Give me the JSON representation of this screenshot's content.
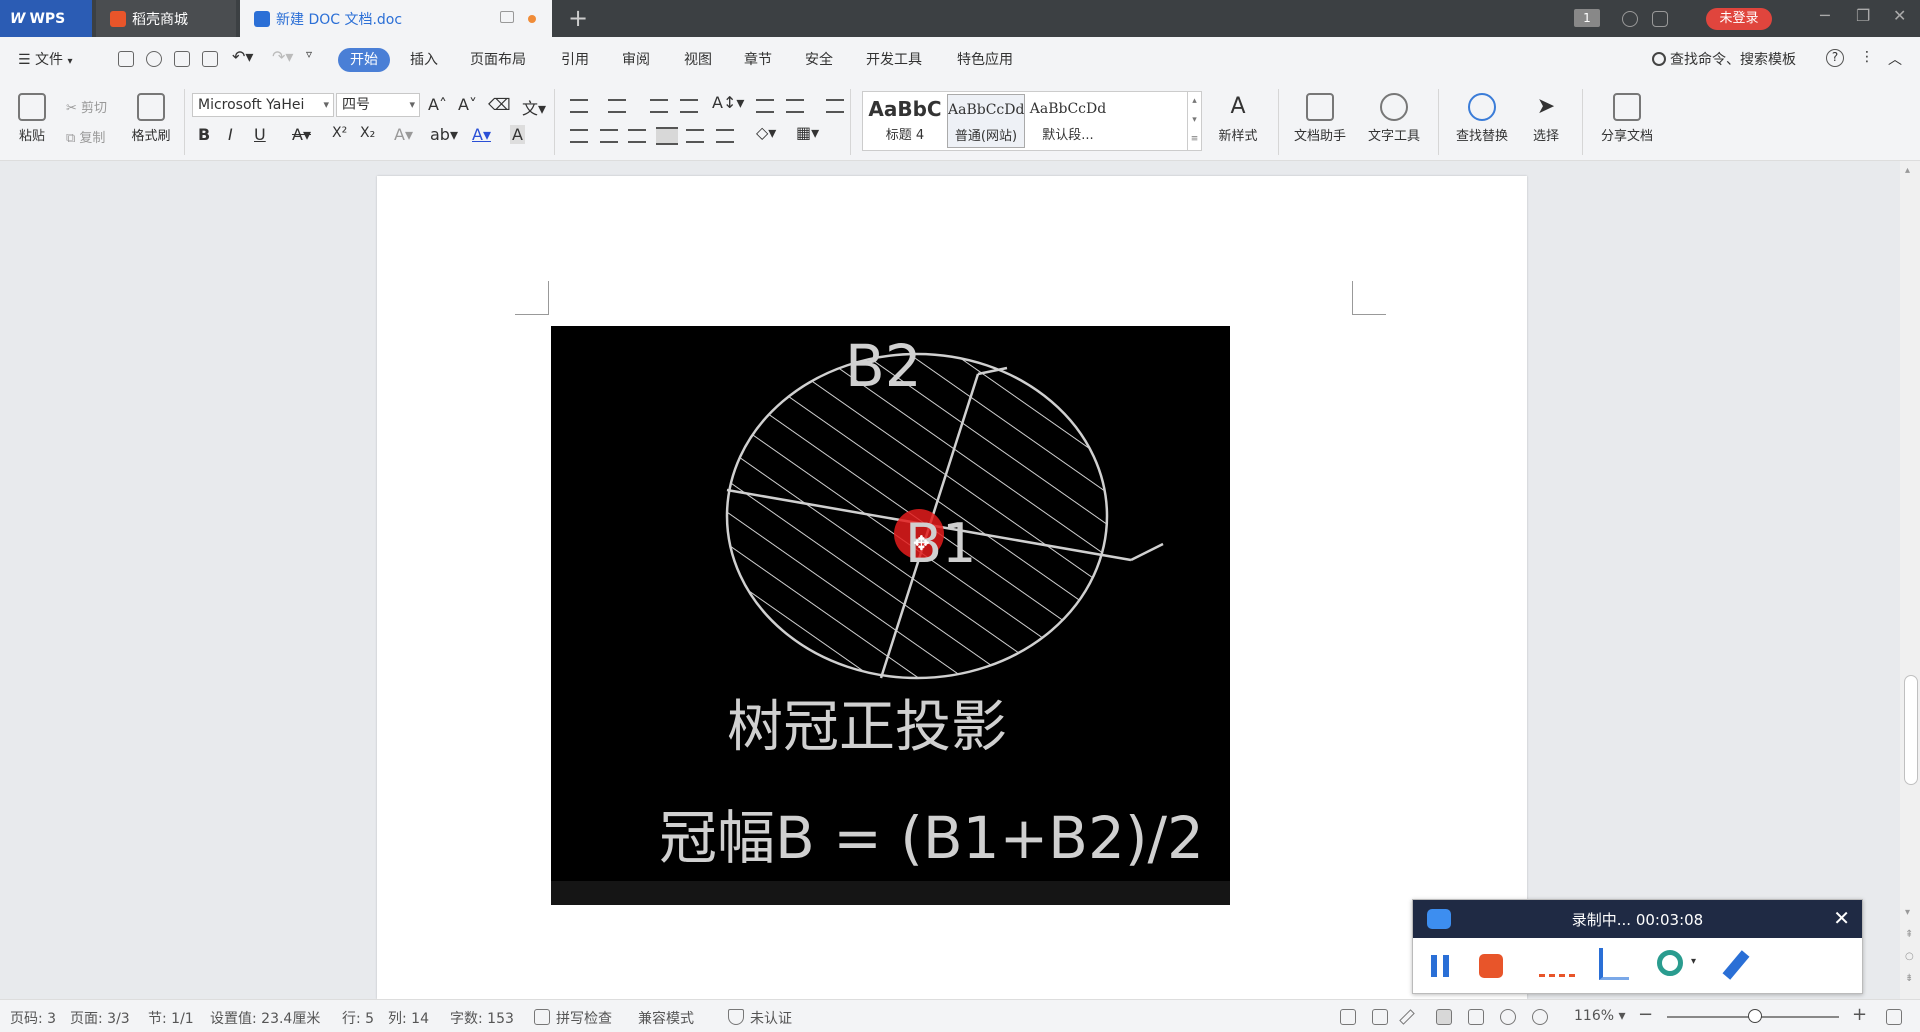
{
  "titlebar": {
    "app_tab": "WPS",
    "store_tab": "稻壳商城",
    "doc_tab": "新建 DOC 文档.doc",
    "new_tab": "+",
    "window_count": "1",
    "login": "未登录",
    "minimize": "─",
    "restore": "❐",
    "close": "✕"
  },
  "menubar": {
    "file": "文件",
    "tabs": [
      "开始",
      "插入",
      "页面布局",
      "引用",
      "审阅",
      "视图",
      "章节",
      "安全",
      "开发工具",
      "特色应用"
    ],
    "search": "查找命令、搜索模板",
    "help": "?",
    "more": "⋮",
    "collapse": "︿"
  },
  "ribbon": {
    "paste": "粘贴",
    "cut": "剪切",
    "copy": "复制",
    "format_painter": "格式刷",
    "font_name": "Microsoft YaHei",
    "font_size": "四号",
    "styles": [
      {
        "sample": "AaBbC",
        "name": "标题 4"
      },
      {
        "sample": "AaBbCcDd",
        "name": "普通(网站)"
      },
      {
        "sample": "AaBbCcDd",
        "name": "默认段..."
      }
    ],
    "new_style": "新样式",
    "doc_helper": "文档助手",
    "text_tools": "文字工具",
    "find_replace": "查找替换",
    "select": "选择",
    "share": "分享文档",
    "bold": "B",
    "italic": "I",
    "underline": "U",
    "superscript": "X²",
    "subscript": "X₂"
  },
  "figure": {
    "label_b2": "B2",
    "label_b1": "B1",
    "caption": "树冠正投影",
    "formula": "冠幅B = (B1+B2)/2"
  },
  "recorder": {
    "status": "录制中... 00:03:08",
    "close": "✕"
  },
  "statusbar": {
    "page_code": "页码: 3",
    "pages": "页面: 3/3",
    "section": "节: 1/1",
    "setting": "设置值: 23.4厘米",
    "row": "行: 5",
    "col": "列: 14",
    "words": "字数: 153",
    "spell": "拼写检查",
    "compat": "兼容模式",
    "cert": "未认证",
    "zoom": "116%",
    "zoom_out": "−",
    "zoom_in": "+"
  },
  "colors": {
    "accent": "#4a7fd6",
    "login": "#e0453d",
    "record_stop": "#e8552a"
  }
}
